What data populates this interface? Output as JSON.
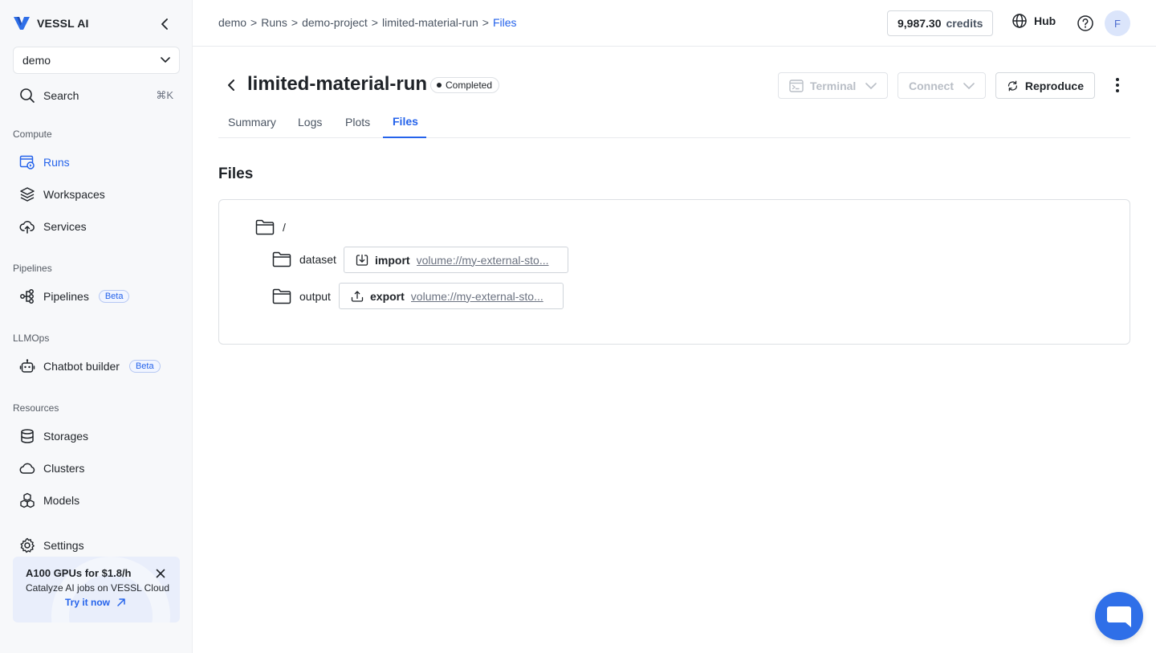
{
  "brand": {
    "name": "VESSL AI"
  },
  "sidebar": {
    "org": "demo",
    "search_label": "Search",
    "search_shortcut": "⌘K",
    "sections": {
      "compute": "Compute",
      "pipelines": "Pipelines",
      "llmops": "LLMOps",
      "resources": "Resources"
    },
    "items": {
      "runs": "Runs",
      "workspaces": "Workspaces",
      "services": "Services",
      "pipelines": "Pipelines",
      "chatbot": "Chatbot builder",
      "storages": "Storages",
      "clusters": "Clusters",
      "models": "Models",
      "settings": "Settings"
    },
    "beta_label": "Beta",
    "promo": {
      "title": "A100 GPUs for $1.8/h",
      "subtitle": "Catalyze AI jobs on VESSL Cloud",
      "link": "Try it now"
    }
  },
  "topbar": {
    "breadcrumb": [
      "demo",
      ">",
      "Runs",
      ">",
      "demo-project",
      ">",
      "limited-material-run",
      ">",
      "Files"
    ],
    "credits_amount": "9,987.30",
    "credits_unit": "credits",
    "hub_label": "Hub",
    "avatar_initial": "F"
  },
  "header": {
    "title": "limited-material-run",
    "status": "Completed",
    "terminal_label": "Terminal",
    "connect_label": "Connect",
    "reproduce_label": "Reproduce"
  },
  "tabs": [
    "Summary",
    "Logs",
    "Plots",
    "Files"
  ],
  "files": {
    "heading": "Files",
    "root": "/",
    "folders": [
      {
        "name": "dataset",
        "kind": "import",
        "path": "volume://my-external-sto..."
      },
      {
        "name": "output",
        "kind": "export",
        "path": "volume://my-external-sto..."
      }
    ]
  },
  "colors": {
    "accent": "#2563eb",
    "fab": "#2f6fe8"
  }
}
